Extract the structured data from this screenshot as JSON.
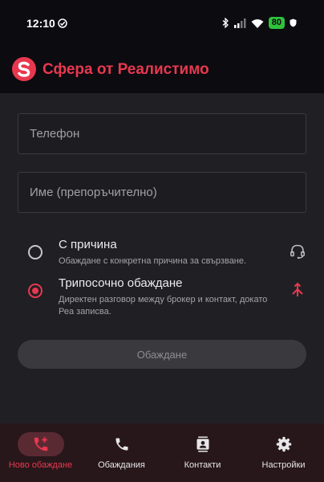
{
  "status_bar": {
    "time": "12:10",
    "battery": "80"
  },
  "header": {
    "title": "Сфера от Реалистимо",
    "logo_letter": "S",
    "brand_color": "#e8384f"
  },
  "form": {
    "phone_placeholder": "Телефон",
    "name_placeholder": "Име (препоръчително)",
    "phone_value": "",
    "name_value": ""
  },
  "options": [
    {
      "title": "С причина",
      "description": "Обаждане с конкретна причина за свързване.",
      "selected": false,
      "icon": "headset-icon"
    },
    {
      "title": "Трипосочно обаждане",
      "description": "Директен разговор между брокер и контакт, докато Реа записва.",
      "selected": true,
      "icon": "merge-icon"
    }
  ],
  "call_button": {
    "label": "Обаждане",
    "enabled": false
  },
  "bottom_nav": {
    "items": [
      {
        "label": "Ново обаждане",
        "icon": "add-call-icon",
        "active": true
      },
      {
        "label": "Обаждания",
        "icon": "phone-icon",
        "active": false
      },
      {
        "label": "Контакти",
        "icon": "contacts-icon",
        "active": false
      },
      {
        "label": "Настройки",
        "icon": "gear-icon",
        "active": false
      }
    ]
  }
}
